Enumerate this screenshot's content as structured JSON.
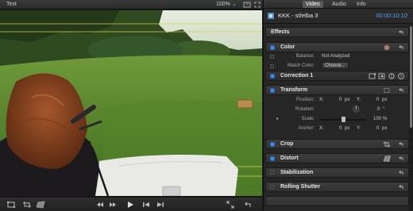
{
  "viewer": {
    "title": "Test",
    "zoom": "100%",
    "zoom_chevron": "⌄",
    "icons": [
      "settings-icon",
      "fullscreen-icon",
      "transform-tool-icon",
      "crop-tool-icon",
      "distort-tool-icon",
      "previous-edit-icon",
      "next-edit-icon",
      "play-icon",
      "go-to-start-icon",
      "go-to-end-icon",
      "fullscreen-view-icon",
      "undo-icon"
    ]
  },
  "inspector": {
    "tabs": {
      "video": "Video",
      "audio": "Audio",
      "info": "Info"
    },
    "clip_name": "KKK - střelba 3",
    "timecode": "00:00:10:10",
    "effects_title": "Effects",
    "color": {
      "title": "Color",
      "balance_label": "Balance:",
      "balance_value": "Not Analyzed",
      "match_label": "Match Color:",
      "match_button": "Choose..."
    },
    "correction_title": "Correction 1",
    "transform": {
      "title": "Transform",
      "position_label": "Position:",
      "position_x_label": "X:",
      "position_x": "0",
      "position_x_unit": "px",
      "position_y_label": "Y:",
      "position_y": "0",
      "position_y_unit": "px",
      "rotation_label": "Rotation:",
      "rotation_value": "0",
      "rotation_unit": "°",
      "scale_label": "Scale:",
      "scale_value": "100",
      "scale_unit": "%",
      "scale_fraction": 0.5,
      "anchor_label": "Anchor:",
      "anchor_x_label": "X:",
      "anchor_x": "0",
      "anchor_x_unit": "px",
      "anchor_y_label": "Y:",
      "anchor_y": "0",
      "anchor_y_unit": "px"
    },
    "crop_title": "Crop",
    "distort_title": "Distort",
    "stabilization_title": "Stabilization",
    "rolling_shutter_title": "Rolling Shutter",
    "accent_color": "#3f88e6",
    "timecode_color": "#5aa7ff"
  }
}
